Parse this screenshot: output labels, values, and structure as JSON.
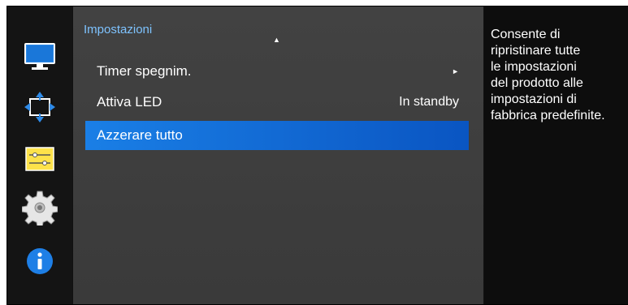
{
  "menu": {
    "title": "Impostazioni",
    "scroll_up_glyph": "▲",
    "items": [
      {
        "label": "Timer spegnim.",
        "value": "",
        "has_submenu": true,
        "arrow_glyph": "►",
        "selected": false
      },
      {
        "label": "Attiva LED",
        "value": "In standby",
        "has_submenu": false,
        "selected": false
      },
      {
        "label": "Azzerare tutto",
        "value": "",
        "has_submenu": false,
        "selected": true
      }
    ]
  },
  "icons": [
    {
      "name": "picture-icon"
    },
    {
      "name": "position-icon"
    },
    {
      "name": "adjust-icon"
    },
    {
      "name": "settings-gear-icon"
    },
    {
      "name": "info-icon"
    }
  ],
  "description": {
    "text": "Consente di\nripristinare tutte\nle impostazioni\ndel prodotto alle\nimpostazioni di\nfabbrica predefinite."
  },
  "colors": {
    "accent": "#1a7fe6",
    "title": "#7ec3ff",
    "panel": "#3e3e3e",
    "background": "#111111"
  }
}
